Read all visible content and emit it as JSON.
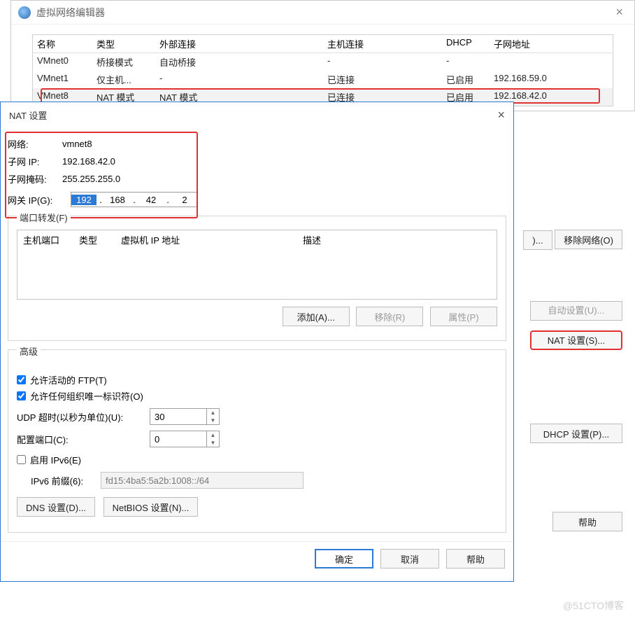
{
  "main": {
    "title": "虚拟网络编辑器",
    "close_x": "×",
    "table_headers": {
      "name": "名称",
      "type": "类型",
      "ext": "外部连接",
      "host": "主机连接",
      "dhcp": "DHCP",
      "subnet": "子网地址"
    },
    "rows": [
      {
        "name": "VMnet0",
        "type": "桥接模式",
        "ext": "自动桥接",
        "host": "-",
        "dhcp": "-",
        "subnet": ""
      },
      {
        "name": "VMnet1",
        "type": "仅主机...",
        "ext": "-",
        "host": "已连接",
        "dhcp": "已启用",
        "subnet": "192.168.59.0"
      },
      {
        "name": "VMnet8",
        "type": "NAT 模式",
        "ext": "NAT 模式",
        "host": "已连接",
        "dhcp": "已启用",
        "subnet": "192.168.42.0"
      }
    ],
    "remove_net": "移除网络(O)",
    "auto_set": "自动设置(U)...",
    "nat_settings": "NAT 设置(S)...",
    "dhcp_settings": "DHCP 设置(P)...",
    "help": "帮助",
    "ellipsis": ")..."
  },
  "dlg": {
    "title": "NAT 设置",
    "close_x": "×",
    "info": {
      "net_label": "网络:",
      "net_value": "vmnet8",
      "subnet_label": "子网 IP:",
      "subnet_value": "192.168.42.0",
      "mask_label": "子网掩码:",
      "mask_value": "255.255.255.0"
    },
    "gateway": {
      "label": "网关 IP(G):",
      "o1": "192",
      "o2": "168",
      "o3": "42",
      "o4": "2"
    },
    "pf": {
      "legend": "端口转发(F)",
      "headers": {
        "host_port": "主机端口",
        "type": "类型",
        "vm_ip": "虚拟机 IP 地址",
        "desc": "描述"
      },
      "add": "添加(A)...",
      "remove": "移除(R)",
      "prop": "属性(P)"
    },
    "adv": {
      "legend": "高级",
      "ftp": "允许活动的 FTP(T)",
      "oui": "允许任何组织唯一标识符(O)",
      "udp_label": "UDP 超时(以秒为单位)(U):",
      "udp_value": "30",
      "cfg_port_label": "配置端口(C):",
      "cfg_port_value": "0",
      "ipv6_enable": "启用 IPv6(E)",
      "ipv6_prefix_label": "IPv6 前缀(6):",
      "ipv6_prefix_value": "fd15:4ba5:5a2b:1008::/64",
      "dns": "DNS 设置(D)...",
      "netbios": "NetBIOS 设置(N)..."
    },
    "footer": {
      "ok": "确定",
      "cancel": "取消",
      "help": "帮助"
    }
  },
  "watermark": "@51CTO博客"
}
